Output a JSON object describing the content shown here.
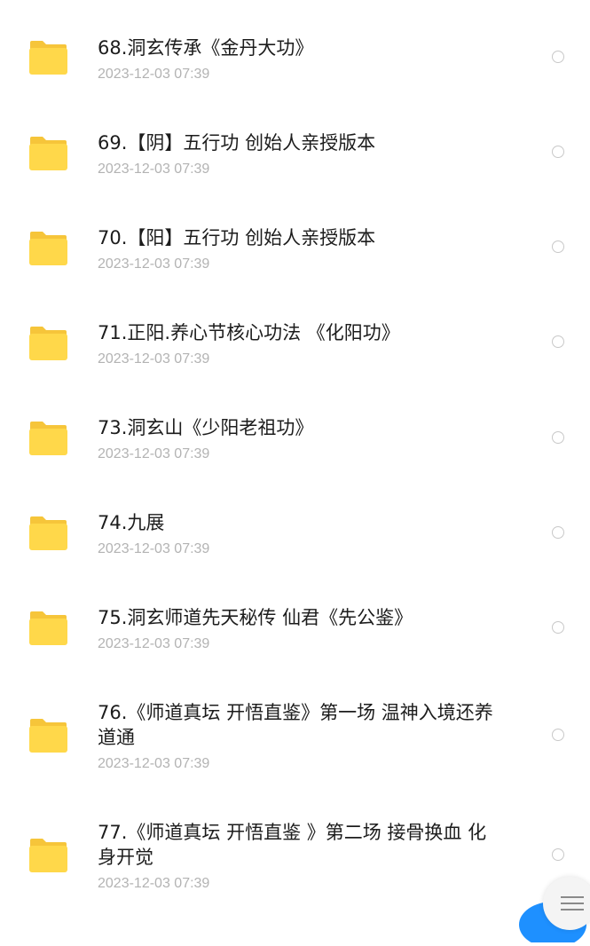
{
  "files": [
    {
      "name": "68.洞玄传承《金丹大功》",
      "date": "2023-12-03 07:39",
      "icon": "folder-icon"
    },
    {
      "name": "69.【阴】五行功 创始人亲授版本",
      "date": "2023-12-03 07:39",
      "icon": "folder-icon"
    },
    {
      "name": "70.【阳】五行功  创始人亲授版本",
      "date": "2023-12-03 07:39",
      "icon": "folder-icon"
    },
    {
      "name": "71.正阳.养心节核心功法 《化阳功》",
      "date": "2023-12-03 07:39",
      "icon": "folder-icon"
    },
    {
      "name": "73.洞玄山《少阳老祖功》",
      "date": "2023-12-03 07:39",
      "icon": "folder-icon"
    },
    {
      "name": "74.九展",
      "date": "2023-12-03 07:39",
      "icon": "folder-icon"
    },
    {
      "name": "75.洞玄师道先天秘传 仙君《先公鉴》",
      "date": "2023-12-03 07:39",
      "icon": "folder-icon"
    },
    {
      "name": "76.《师道真坛 开悟直鉴》第一场 温神入境还养道通",
      "date": "2023-12-03 07:39",
      "icon": "folder-icon"
    },
    {
      "name": "77.《师道真坛 开悟直鉴 》第二场  接骨换血 化身开觉",
      "date": "2023-12-03 07:39",
      "icon": "folder-icon"
    }
  ],
  "colors": {
    "folder_front": "#FFD84A",
    "folder_back": "#F6C53A",
    "date_text": "#B3B3B3",
    "radio_border": "#C8C8C8",
    "fab_blue": "#1E90FF"
  },
  "floating": {
    "fab_icon": "blue-circle-icon",
    "menu_icon": "hamburger-menu-icon"
  }
}
